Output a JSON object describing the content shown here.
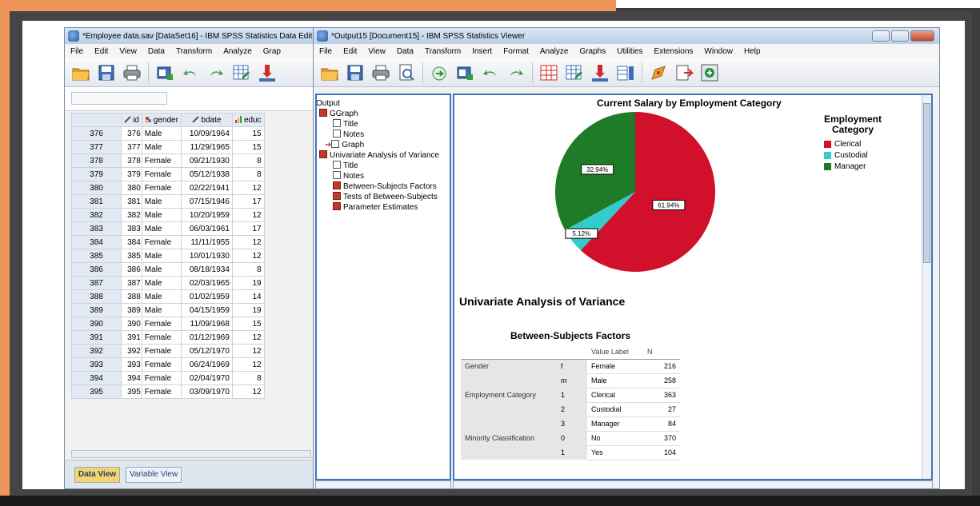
{
  "editor": {
    "title": "*Employee data.sav [DataSet16] - IBM SPSS Statistics Data Edit",
    "menus": [
      "File",
      "Edit",
      "View",
      "Data",
      "Transform",
      "Analyze",
      "Grap"
    ],
    "columns": [
      "id",
      "gender",
      "bdate",
      "educ"
    ],
    "rows": [
      [
        "376",
        "376",
        "Male",
        "10/09/1964",
        "15"
      ],
      [
        "377",
        "377",
        "Male",
        "11/29/1965",
        "15"
      ],
      [
        "378",
        "378",
        "Female",
        "09/21/1930",
        "8"
      ],
      [
        "379",
        "379",
        "Female",
        "05/12/1938",
        "8"
      ],
      [
        "380",
        "380",
        "Female",
        "02/22/1941",
        "12"
      ],
      [
        "381",
        "381",
        "Male",
        "07/15/1946",
        "17"
      ],
      [
        "382",
        "382",
        "Male",
        "10/20/1959",
        "12"
      ],
      [
        "383",
        "383",
        "Male",
        "06/03/1961",
        "17"
      ],
      [
        "384",
        "384",
        "Female",
        "11/11/1955",
        "12"
      ],
      [
        "385",
        "385",
        "Male",
        "10/01/1930",
        "12"
      ],
      [
        "386",
        "386",
        "Male",
        "08/18/1934",
        "8"
      ],
      [
        "387",
        "387",
        "Male",
        "02/03/1965",
        "19"
      ],
      [
        "388",
        "388",
        "Male",
        "01/02/1959",
        "14"
      ],
      [
        "389",
        "389",
        "Male",
        "04/15/1959",
        "19"
      ],
      [
        "390",
        "390",
        "Female",
        "11/09/1968",
        "15"
      ],
      [
        "391",
        "391",
        "Female",
        "01/12/1969",
        "12"
      ],
      [
        "392",
        "392",
        "Female",
        "05/12/1970",
        "12"
      ],
      [
        "393",
        "393",
        "Female",
        "06/24/1969",
        "12"
      ],
      [
        "394",
        "394",
        "Female",
        "02/04/1970",
        "8"
      ],
      [
        "395",
        "395",
        "Female",
        "03/09/1970",
        "12"
      ]
    ],
    "tabs": {
      "data_view": "Data View",
      "variable_view": "Variable View"
    }
  },
  "viewer": {
    "title": "*Output15 [Document15] - IBM SPSS Statistics Viewer",
    "menus": [
      "File",
      "Edit",
      "View",
      "Data",
      "Transform",
      "Insert",
      "Format",
      "Analyze",
      "Graphs",
      "Utilities",
      "Extensions",
      "Window",
      "Help"
    ],
    "outline": {
      "root": "Output",
      "ggraph": "GGraph",
      "ggraph_title": "Title",
      "ggraph_notes": "Notes",
      "graph": "Graph",
      "uav": "Univariate Analysis of Variance",
      "uav_title": "Title",
      "uav_notes": "Notes",
      "bsf": "Between-Subjects Factors",
      "tests": "Tests of Between-Subjects",
      "params": "Parameter Estimates"
    },
    "uav_heading": "Univariate Analysis of Variance",
    "bsf_heading": "Between-Subjects Factors",
    "bsf_header": {
      "value_label": "Value Label",
      "n": "N"
    },
    "bsf_rows": [
      {
        "factor": "Gender",
        "code": "f",
        "label": "Female",
        "n": "216"
      },
      {
        "factor": "",
        "code": "m",
        "label": "Male",
        "n": "258"
      },
      {
        "factor": "Employment Category",
        "code": "1",
        "label": "Clerical",
        "n": "363"
      },
      {
        "factor": "",
        "code": "2",
        "label": "Custodial",
        "n": "27"
      },
      {
        "factor": "",
        "code": "3",
        "label": "Manager",
        "n": "84"
      },
      {
        "factor": "Minority Classification",
        "code": "0",
        "label": "No",
        "n": "370"
      },
      {
        "factor": "",
        "code": "1",
        "label": "Yes",
        "n": "104"
      }
    ]
  },
  "chart_data": {
    "type": "pie",
    "title": "Current Salary by Employment Category",
    "legend_title": "Employment Category",
    "legend_title_lines": [
      "Employment",
      "Category"
    ],
    "categories": [
      "Clerical",
      "Custodial",
      "Manager"
    ],
    "values": [
      61.94,
      5.12,
      32.94
    ],
    "labels": [
      "61.94%",
      "5.12%",
      "32.94%"
    ],
    "colors": [
      "#d1112b",
      "#33cccc",
      "#1e7b27"
    ],
    "legend_position": "right"
  }
}
